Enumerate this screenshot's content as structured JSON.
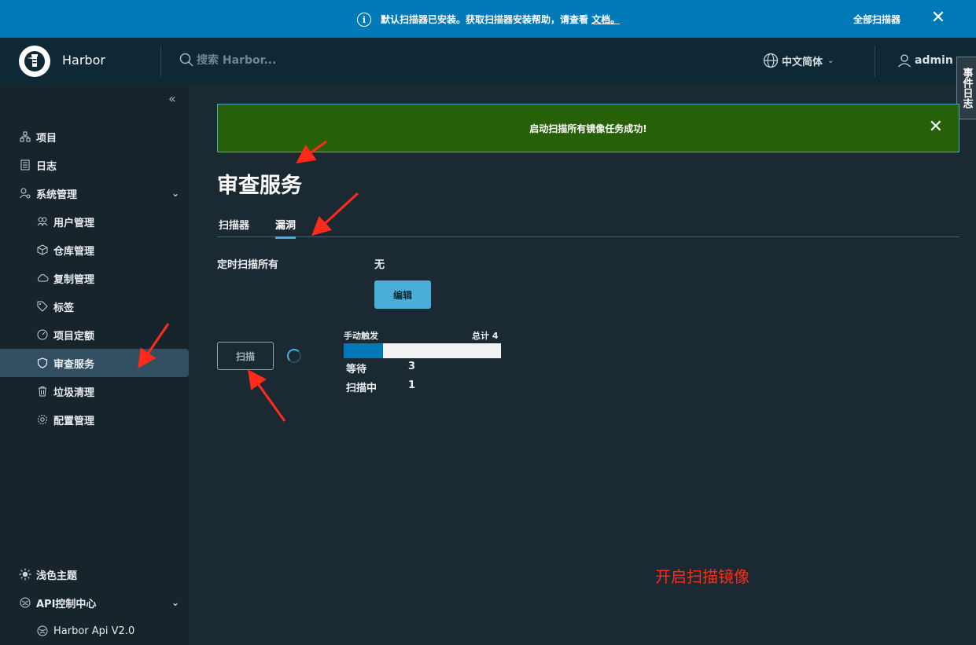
{
  "banner": {
    "message": "默认扫描器已安装。获取扫描器安装帮助，请查看 ",
    "link_text": "文档。",
    "all_scanners": "全部扫描器",
    "close": "✕",
    "color": "#0079b8"
  },
  "header": {
    "brand": "Harbor",
    "search_placeholder": "搜索 Harbor...",
    "language": "中文简体",
    "user": "admin"
  },
  "event_log_tab": "事件日志",
  "sidebar": {
    "collapse": "«",
    "items": [
      {
        "label": "项目",
        "icon": "projects-icon"
      },
      {
        "label": "日志",
        "icon": "logs-icon"
      },
      {
        "label": "系统管理",
        "icon": "admin-icon"
      },
      {
        "label": "用户管理",
        "icon": "users-icon"
      },
      {
        "label": "仓库管理",
        "icon": "registry-icon"
      },
      {
        "label": "复制管理",
        "icon": "replication-icon"
      },
      {
        "label": "标签",
        "icon": "tag-icon"
      },
      {
        "label": "项目定额",
        "icon": "quota-icon"
      },
      {
        "label": "审查服务",
        "icon": "shield-icon"
      },
      {
        "label": "垃圾清理",
        "icon": "trash-icon"
      },
      {
        "label": "配置管理",
        "icon": "gear-icon"
      }
    ],
    "bottom": [
      {
        "label": "浅色主题",
        "icon": "sun-icon"
      },
      {
        "label": "API控制中心",
        "icon": "api-icon"
      },
      {
        "label": "Harbor Api V2.0",
        "icon": "api-sub-icon"
      }
    ]
  },
  "alert": {
    "text": "启动扫描所有镜像任务成功!",
    "color": "#266109"
  },
  "main": {
    "title": "审查服务",
    "tabs": [
      "扫描器",
      "漏洞"
    ],
    "active_tab": "漏洞",
    "schedule_label": "定时扫描所有",
    "schedule_value": "无",
    "edit_button": "编辑",
    "scan_button": "扫描"
  },
  "stats": {
    "trigger_label": "手动触发",
    "total_label": "总计 4",
    "total": 4,
    "progress_fraction": 0.25,
    "rows": [
      {
        "label": "等待",
        "value": "3"
      },
      {
        "label": "扫描中",
        "value": "1"
      }
    ]
  },
  "annotation": "开启扫描镜像"
}
